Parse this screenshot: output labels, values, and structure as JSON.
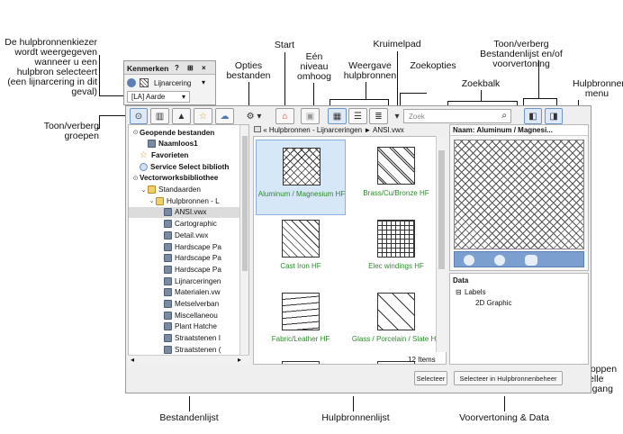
{
  "palette": {
    "title": "Kenmerken",
    "controls": [
      "?",
      "⊞",
      "×"
    ],
    "linetype_label": "Lijnarcering",
    "class_value": "[LA] Aarde"
  },
  "toolbar": {
    "search_placeholder": "Zoek"
  },
  "breadcrumb": {
    "back": "«",
    "path": "Hulpbronnen - Lijnarceringen",
    "sep": "►",
    "file": "ANSI.vwx"
  },
  "tree": [
    {
      "label": "Geopende bestanden",
      "icon": "twirl",
      "level": 0,
      "bold": true
    },
    {
      "label": "Naamloos1",
      "icon": "doc",
      "level": 1,
      "bold": true
    },
    {
      "label": "Favorieten",
      "icon": "star",
      "level": 0,
      "bold": true
    },
    {
      "label": "Service Select biblioth",
      "icon": "cloud",
      "level": 0,
      "bold": true
    },
    {
      "label": "Vectorworksbibliothee",
      "icon": "twirl",
      "level": 0,
      "bold": true
    },
    {
      "label": "Standaarden",
      "icon": "folder",
      "level": 1,
      "bold": false
    },
    {
      "label": "Hulpbronnen - L",
      "icon": "folder",
      "level": 2,
      "bold": false
    },
    {
      "label": "ANSI.vwx",
      "icon": "doc",
      "level": 3,
      "bold": false,
      "selected": true
    },
    {
      "label": "Cartographic",
      "icon": "doc",
      "level": 3,
      "bold": false
    },
    {
      "label": "Detail.vwx",
      "icon": "doc",
      "level": 3,
      "bold": false
    },
    {
      "label": "Hardscape Pa",
      "icon": "doc",
      "level": 3,
      "bold": false
    },
    {
      "label": "Hardscape Pa",
      "icon": "doc",
      "level": 3,
      "bold": false
    },
    {
      "label": "Hardscape Pa",
      "icon": "doc",
      "level": 3,
      "bold": false
    },
    {
      "label": "Lijnarceringen",
      "icon": "doc",
      "level": 3,
      "bold": false
    },
    {
      "label": "Materialen.vw",
      "icon": "doc",
      "level": 3,
      "bold": false
    },
    {
      "label": "Metselverban",
      "icon": "doc",
      "level": 3,
      "bold": false
    },
    {
      "label": "Miscellaneou",
      "icon": "doc",
      "level": 3,
      "bold": false
    },
    {
      "label": "Plant Hatche",
      "icon": "doc",
      "level": 3,
      "bold": false
    },
    {
      "label": "Straatstenen I",
      "icon": "doc",
      "level": 3,
      "bold": false
    },
    {
      "label": "Straatstenen (",
      "icon": "doc",
      "level": 3,
      "bold": false
    }
  ],
  "tiles": [
    {
      "label": "Aluminum / Magnesium HF",
      "pattern": "diag-cross",
      "selected": true
    },
    {
      "label": "Brass/Cu/Bronze HF",
      "pattern": "diag-pair"
    },
    {
      "label": "Cast Iron HF",
      "pattern": "diag"
    },
    {
      "label": "Elec windings HF",
      "pattern": "grid"
    },
    {
      "label": "Fabric/Leather HF",
      "pattern": "wave"
    },
    {
      "label": "Glass / Porcelain / Slate HF",
      "pattern": "diag-sparse"
    }
  ],
  "item_count": "12 Items",
  "preview": {
    "title": "Naam: Aluminum / Magnesi..."
  },
  "data_panel": {
    "title": "Data",
    "group": "Labels",
    "item": "2D Graphic"
  },
  "buttons": {
    "select": "Selecteer",
    "select_in_manager": "Selecteer in Hulpbronnenbeheer"
  },
  "callouts": {
    "kiezer": "De hulpbronnenkiezer wordt weergegeven wanneer u een hulpbron selecteert (een lijnarcering in dit geval)",
    "toon_verberg_groepen": "Toon/verberg groepen",
    "opties": "Opties bestanden",
    "start": "Start",
    "een_niveau": "Eén niveau omhoog",
    "weergave": "Weergave hulpbronnen",
    "kruimelpad": "Kruimelpad",
    "zoekopties": "Zoekopties",
    "zoekbalk": "Zoekbalk",
    "toon_verberg_lijst": "Toon/verberg Bestandenlijst en/of voorvertoning",
    "menu": "Hulpbronnen menu",
    "knoppen": "Knoppen snelle toegang",
    "bestandenlijst": "Bestandenlijst",
    "hulpbronnenlijst": "Hulpbronnenlijst",
    "voorvertoning": "Voorvertoning & Data"
  }
}
